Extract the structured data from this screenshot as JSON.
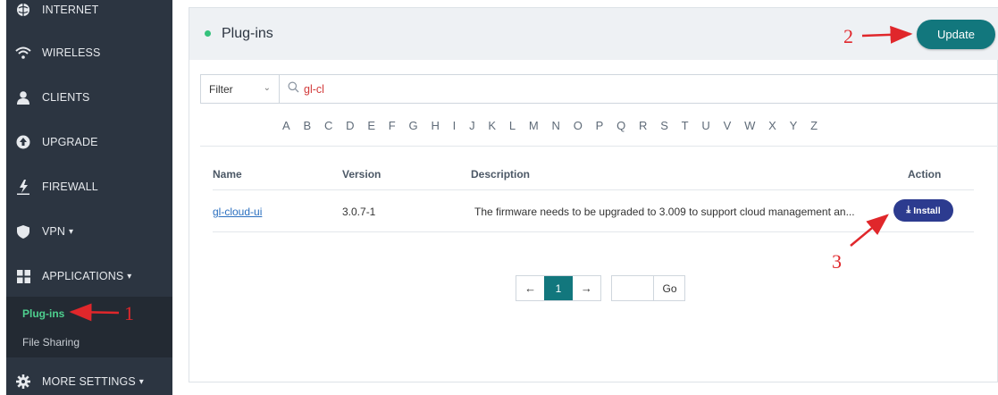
{
  "sidebar": {
    "items": [
      {
        "label": "INTERNET",
        "icon": "globe-icon"
      },
      {
        "label": "WIRELESS",
        "icon": "wifi-icon"
      },
      {
        "label": "CLIENTS",
        "icon": "user-icon"
      },
      {
        "label": "UPGRADE",
        "icon": "upgrade-icon"
      },
      {
        "label": "FIREWALL",
        "icon": "firewall-icon"
      },
      {
        "label": "VPN",
        "icon": "shield-icon",
        "caret": "▾"
      },
      {
        "label": "APPLICATIONS",
        "icon": "apps-grid-icon",
        "caret": "▾"
      },
      {
        "label": "MORE SETTINGS",
        "icon": "gear-icon",
        "caret": "▾"
      }
    ],
    "submenu": [
      {
        "label": "Plug-ins",
        "active": true
      },
      {
        "label": "File Sharing",
        "active": false
      }
    ]
  },
  "header": {
    "title": "Plug-ins",
    "update_label": "Update"
  },
  "filter": {
    "select_label": "Filter",
    "search_value": "gl-cl"
  },
  "alphabet": [
    "A",
    "B",
    "C",
    "D",
    "E",
    "F",
    "G",
    "H",
    "I",
    "J",
    "K",
    "L",
    "M",
    "N",
    "O",
    "P",
    "Q",
    "R",
    "S",
    "T",
    "U",
    "V",
    "W",
    "X",
    "Y",
    "Z"
  ],
  "table": {
    "columns": [
      "Name",
      "Version",
      "Description",
      "Action"
    ],
    "rows": [
      {
        "name": "gl-cloud-ui",
        "version": "3.0.7-1",
        "description": "The firmware needs to be upgraded to 3.009 to support cloud management an...",
        "action": "Install"
      }
    ]
  },
  "pagination": {
    "prev_icon": "←",
    "current_page": "1",
    "next_icon": "→",
    "goto_value": "",
    "go_label": "Go"
  },
  "annotations": {
    "n1": "1",
    "n2": "2",
    "n3": "3",
    "color": "#e0272b"
  },
  "colors": {
    "sidebar_bg": "#2c3541",
    "accent_teal": "#12777d",
    "install_blue": "#2c3b8f",
    "active_green": "#4ed08f"
  }
}
